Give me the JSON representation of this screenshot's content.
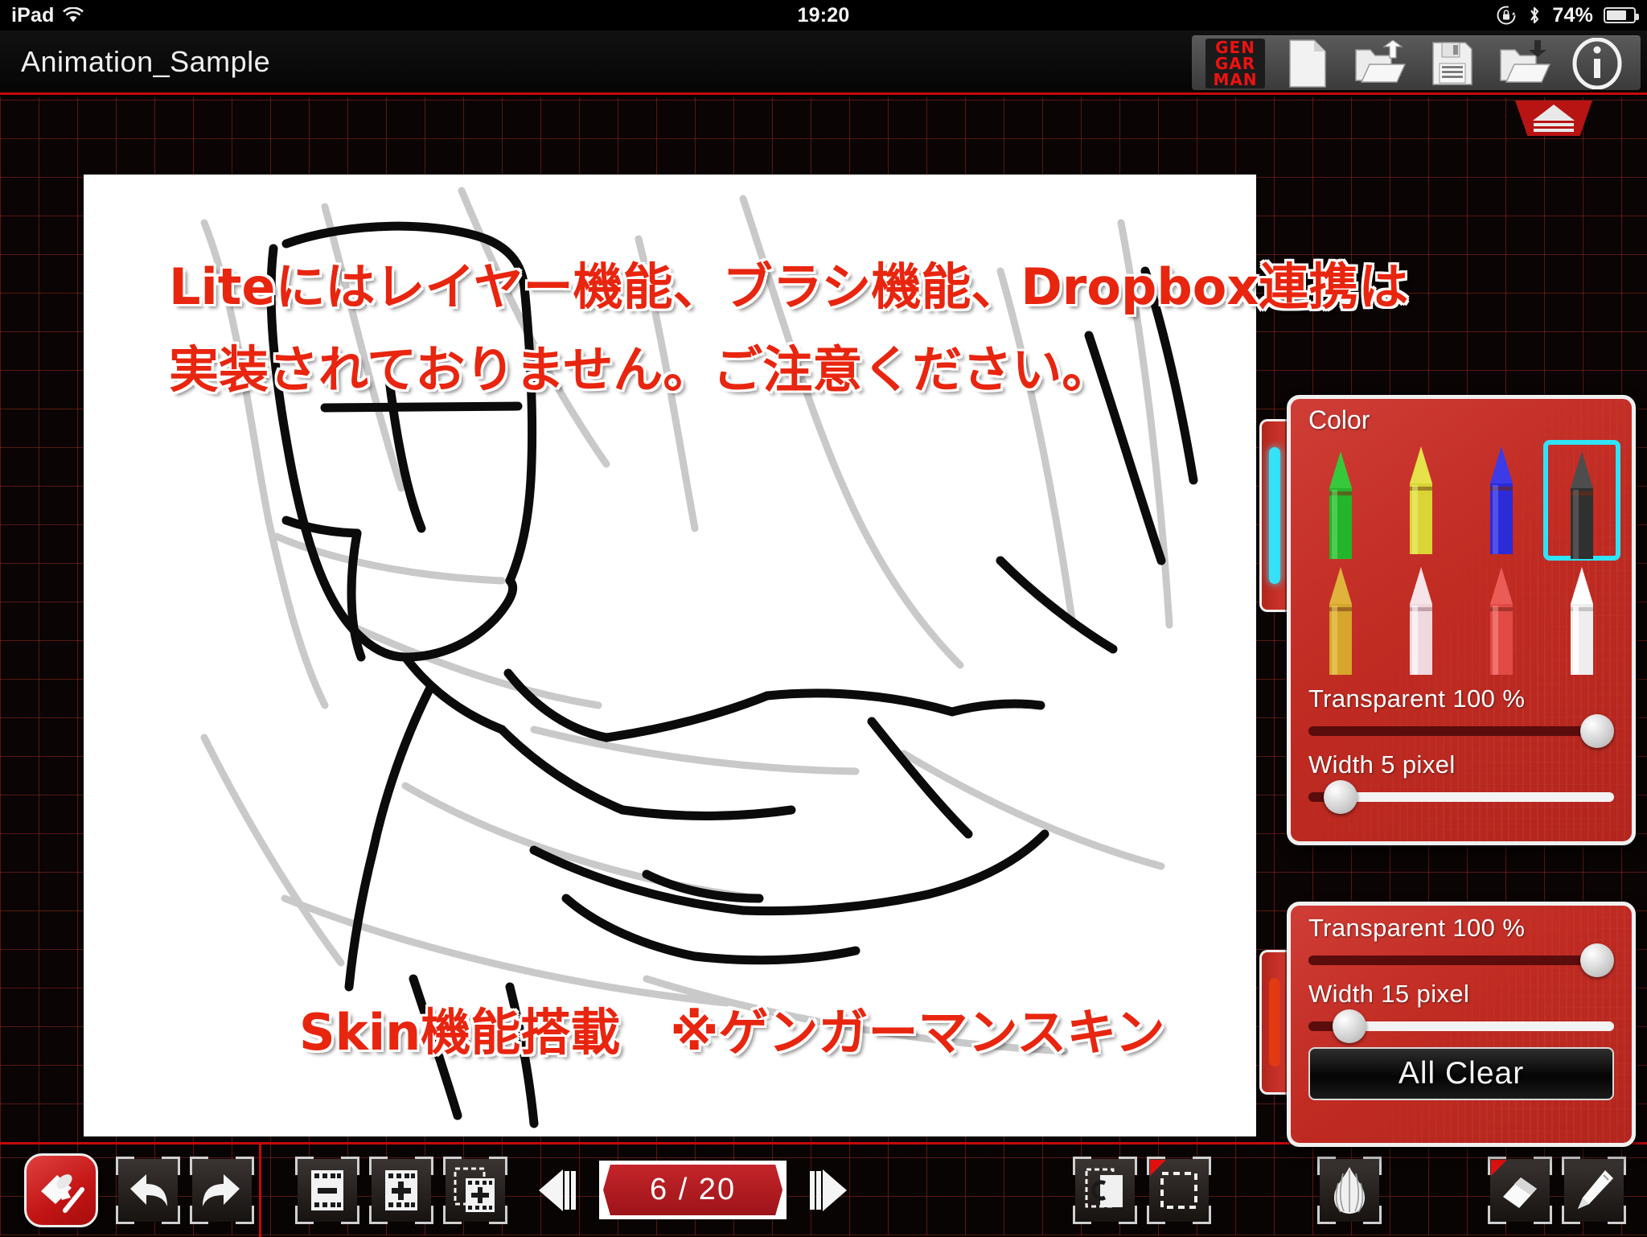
{
  "status_bar": {
    "device": "iPad",
    "wifi_icon": "wifi-icon",
    "time": "19:20",
    "rotation_lock_icon": "rotation-lock-icon",
    "bluetooth_icon": "bluetooth-icon",
    "battery_percent": "74%",
    "battery_level": 74
  },
  "titlebar": {
    "app_title": "Animation_Sample",
    "tools": [
      {
        "name": "gengarman-logo",
        "label": "GEN GAR MAN",
        "lines": [
          "GEN",
          "GAR",
          "MAN"
        ]
      },
      {
        "name": "new-document-button",
        "label": "New"
      },
      {
        "name": "open-file-button",
        "label": "Open"
      },
      {
        "name": "save-file-button",
        "label": "Save"
      },
      {
        "name": "import-file-button",
        "label": "Import"
      },
      {
        "name": "info-button",
        "label": "Info"
      }
    ]
  },
  "canvas": {
    "overlay_lines": [
      "Liteにはレイヤー機能、ブラシ機能、Dropbox連携は",
      "実装されておりません。ご注意ください。",
      "Skin機能搭載　※ゲンガーマンスキン"
    ],
    "onion_skin_enabled": true
  },
  "color_panel": {
    "title": "Color",
    "crayons": [
      {
        "name": "crayon-green",
        "color": "#24b52b",
        "selected": false
      },
      {
        "name": "crayon-yellow",
        "color": "#d9d534",
        "selected": false
      },
      {
        "name": "crayon-blue",
        "color": "#2b2bd8",
        "selected": false
      },
      {
        "name": "crayon-black",
        "color": "#3a3a3a",
        "selected": true
      },
      {
        "name": "crayon-gold",
        "color": "#d6a62c",
        "selected": false
      },
      {
        "name": "crayon-pink",
        "color": "#efd9df",
        "selected": false
      },
      {
        "name": "crayon-red",
        "color": "#e24a45",
        "selected": false
      },
      {
        "name": "crayon-white",
        "color": "#f2f2f2",
        "selected": false
      }
    ],
    "transparent_label": "Transparent  100 %",
    "transparent_value": 100,
    "width_label": "Width   5 pixel",
    "width_value": 5
  },
  "brush_panel": {
    "transparent_label": "Transparent  100 %",
    "transparent_value": 100,
    "width_label": "Width   15 pixel",
    "width_value": 15,
    "all_clear_label": "All Clear"
  },
  "panel_toggles": {
    "collapse_top_label": "collapse-top",
    "collapse_bottom_label": "collapse-bottom"
  },
  "bottom_toolbar": {
    "paint_tool": {
      "name": "paint-bucket-tool",
      "label": "Fill"
    },
    "history": [
      {
        "name": "undo-button",
        "label": "Undo"
      },
      {
        "name": "redo-button",
        "label": "Redo"
      }
    ],
    "frame_tools": [
      {
        "name": "delete-frame-button",
        "label": "Delete Frame"
      },
      {
        "name": "add-frame-button",
        "label": "Add Frame"
      },
      {
        "name": "duplicate-frame-button",
        "label": "Duplicate Frame"
      }
    ],
    "frame_nav": {
      "prev_label": "Previous Frame",
      "next_label": "Next Frame",
      "counter": "6 /  20",
      "current_frame": 6,
      "total_frames": 20
    },
    "right_tools": [
      {
        "name": "copy-paste-button",
        "label": "Copy",
        "badge": false
      },
      {
        "name": "select-region-button",
        "label": "Select",
        "badge": true
      },
      {
        "name": "onion-skin-button",
        "label": "Onion Skin",
        "badge": false
      },
      {
        "name": "eraser-tool-button",
        "label": "Eraser",
        "badge": true
      },
      {
        "name": "pen-tool-button",
        "label": "Pen",
        "badge": false
      }
    ]
  },
  "colors": {
    "accent_red": "#c40a0a",
    "panel_red": "#c02b22",
    "selection_cyan": "#2fe3f7",
    "grid_line": "#962821",
    "overlay_text": "#e8250f"
  }
}
